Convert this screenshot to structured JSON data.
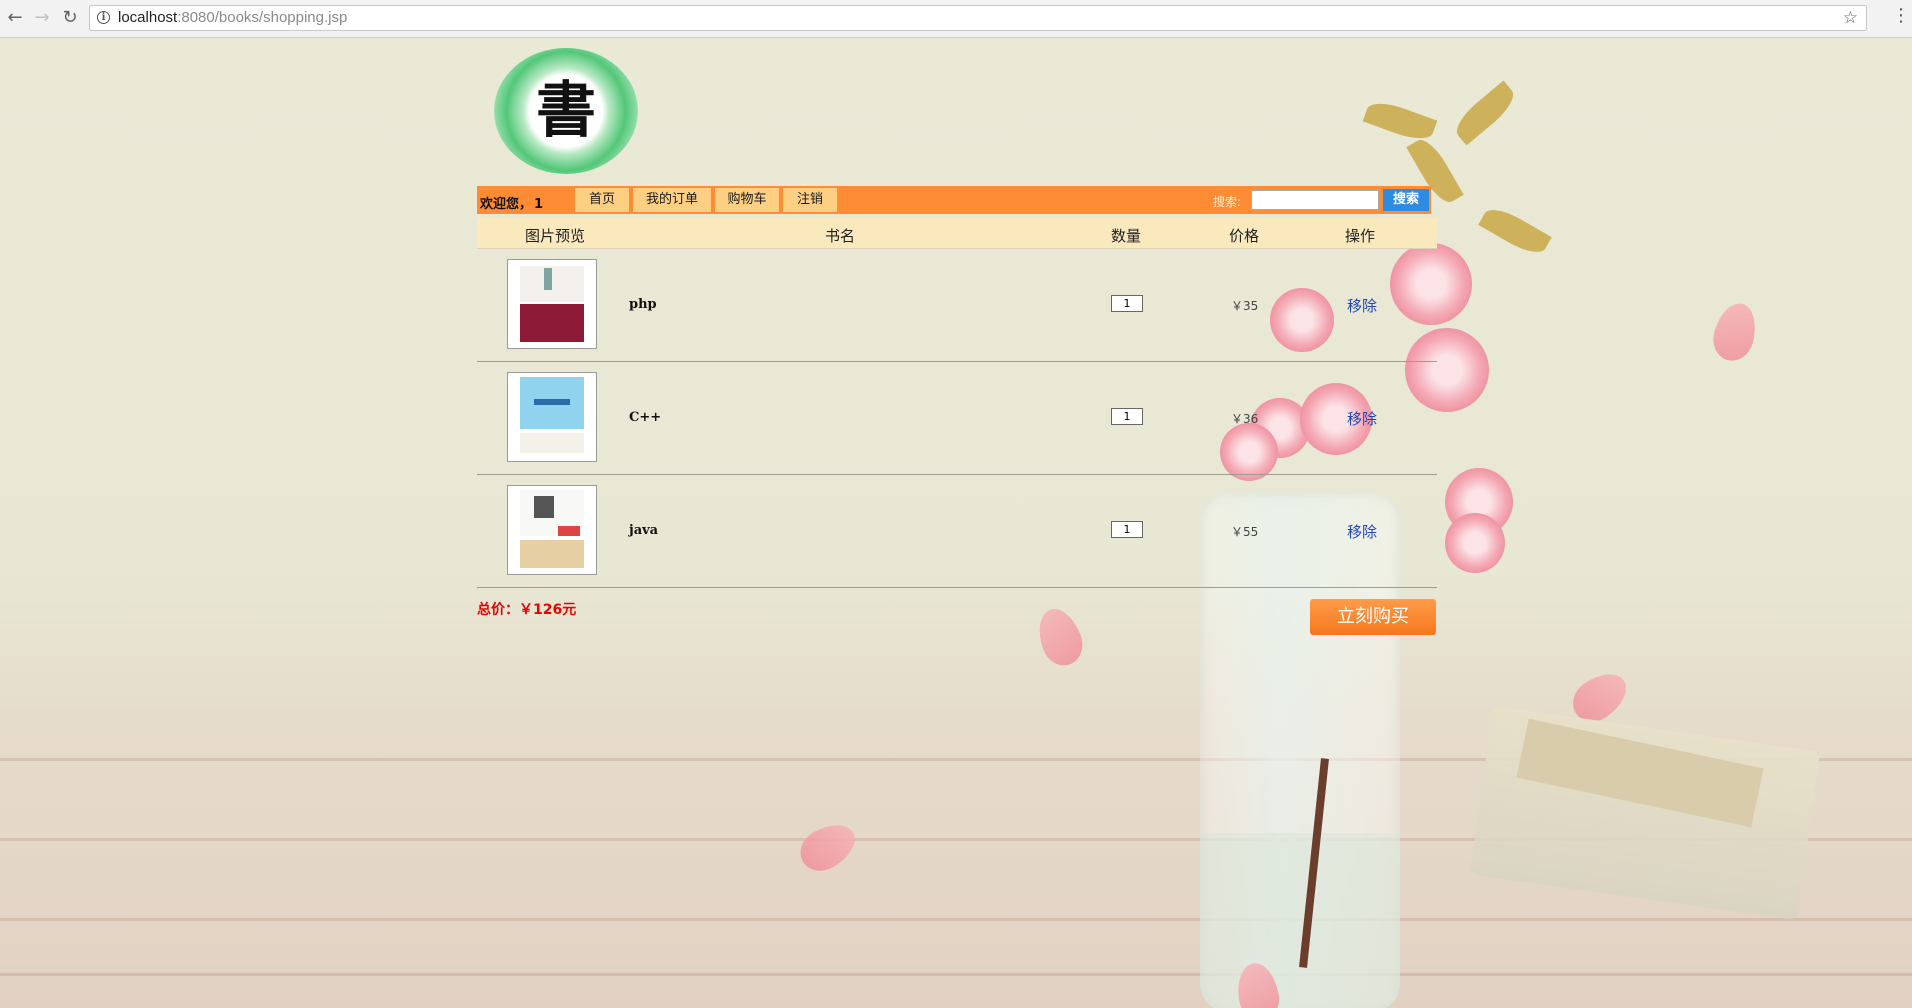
{
  "browser": {
    "url_host": "localhost",
    "url_rest": ":8080/books/shopping.jsp"
  },
  "logo": {
    "char": "書"
  },
  "navbar": {
    "welcome_label": "欢迎您，",
    "username": "1",
    "links": [
      "首页",
      "我的订单",
      "购物车",
      "注销"
    ],
    "search_label": "搜索:",
    "search_value": "",
    "search_button": "搜索"
  },
  "table": {
    "headers": [
      "图片预览",
      "书名",
      "数量",
      "价格",
      "操作"
    ],
    "rows": [
      {
        "name": "php",
        "quantity": "1",
        "price": "￥35",
        "action": "移除"
      },
      {
        "name": "C++",
        "quantity": "1",
        "price": "￥36",
        "action": "移除"
      },
      {
        "name": "java",
        "quantity": "1",
        "price": "￥55",
        "action": "移除"
      }
    ]
  },
  "total_label": "总价：￥126元",
  "buy_button": "立刻购买",
  "colors": {
    "navbar": "#fd8c35",
    "navlink": "#fdcf83",
    "header_row": "#fbe9be",
    "total_text": "#e40404",
    "link": "#2145b7",
    "search_button": "#2d8be0",
    "buy_button": "#f5771d"
  }
}
